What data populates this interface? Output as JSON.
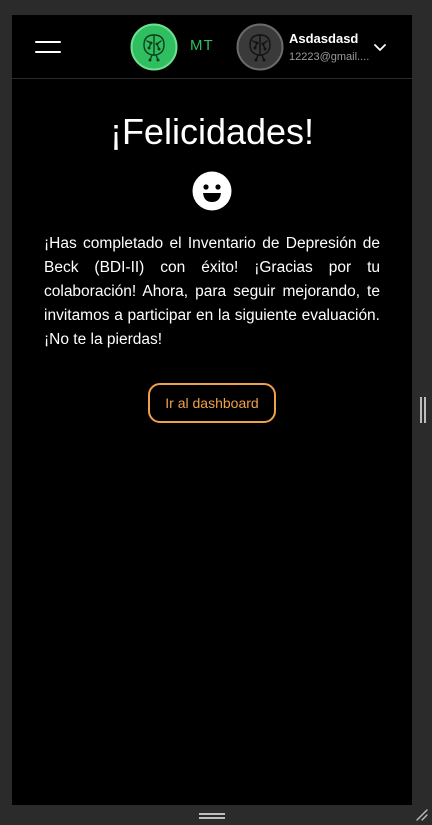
{
  "header": {
    "menu_icon": "hamburger-menu-icon",
    "logo_icon": "brain-circuit-logo-icon",
    "logo_text": "MT",
    "brand_color": "#2fbf60",
    "avatar_icon": "brain-circuit-avatar-icon",
    "user_name": "Asdasdasd",
    "user_email": "12223@gmail.com",
    "user_email_display": "12223@gmail....",
    "dropdown_icon": "chevron-down-icon"
  },
  "main": {
    "title": "¡Felicidades!",
    "emoji_icon": "smiley-face-icon",
    "message": "¡Has completado el Inventario de Depresión de Beck (BDI-II) con éxito! ¡Gracias por tu colaboración! Ahora, para seguir mejorando, te invitamos a participar en la siguiente evaluación. ¡No te la pierdas!",
    "cta_label": "Ir al dashboard",
    "accent_color": "#f0a04b"
  },
  "frame": {
    "side_resize_icon": "vertical-resize-handle-icon",
    "bottom_resize_icon": "horizontal-resize-handle-icon",
    "corner_resize_icon": "corner-resize-grip-icon"
  }
}
